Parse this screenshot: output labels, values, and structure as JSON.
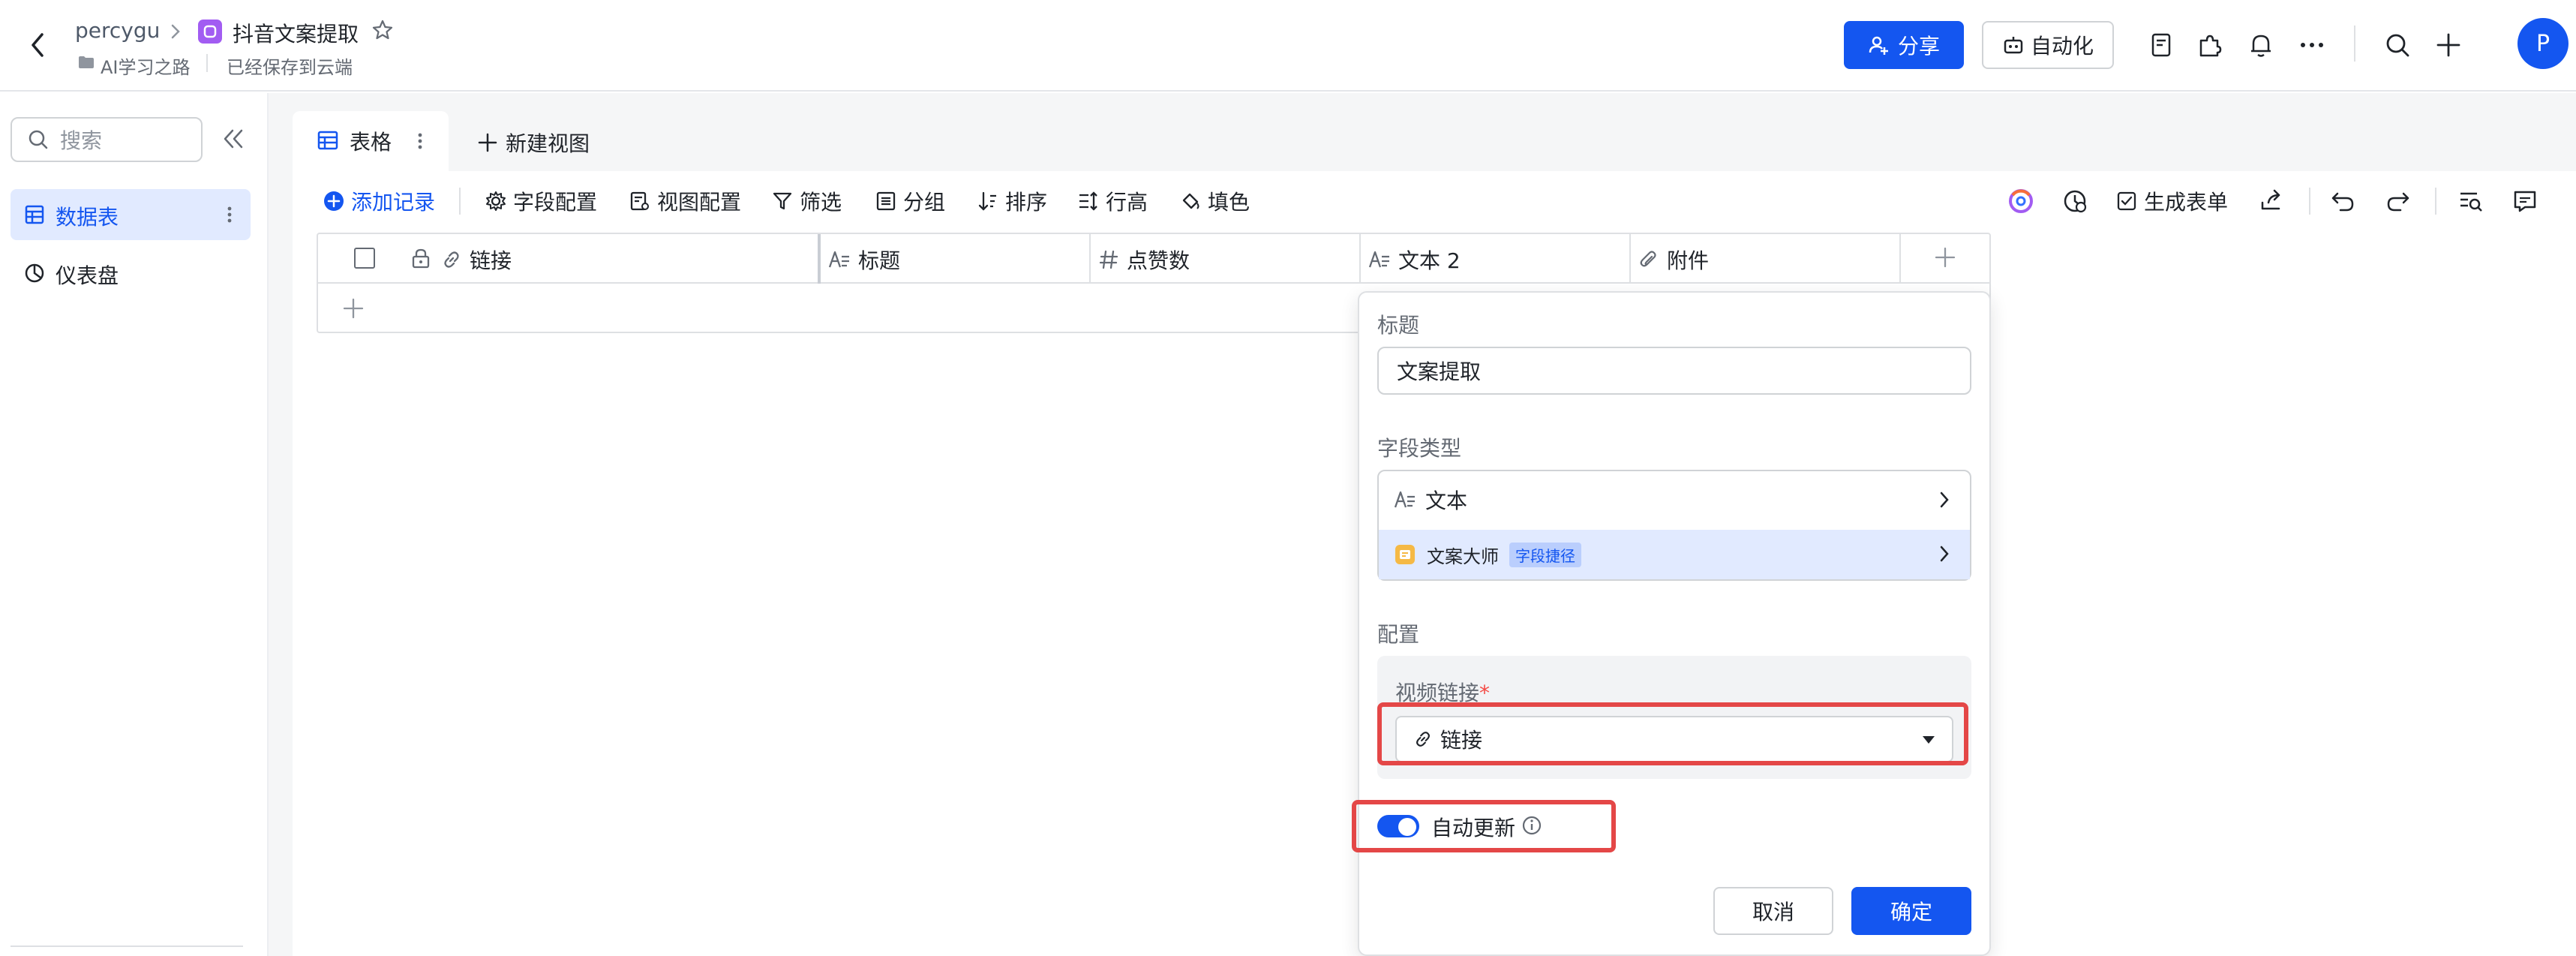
{
  "header": {
    "breadcrumb_user": "percygu",
    "doc_title": "抖音文案提取",
    "folder": "AI学习之路",
    "save_status": "已经保存到云端",
    "share_label": "分享",
    "automation_label": "自动化",
    "avatar_letter": "P"
  },
  "sidebar": {
    "search_placeholder": "搜索",
    "items": [
      {
        "label": "数据表",
        "active": true
      },
      {
        "label": "仪表盘",
        "active": false
      }
    ]
  },
  "views": {
    "tabs": [
      {
        "label": "表格"
      }
    ],
    "new_view_label": "新建视图"
  },
  "toolbar": {
    "add_record": "添加记录",
    "field_config": "字段配置",
    "view_config": "视图配置",
    "filter": "筛选",
    "group": "分组",
    "sort": "排序",
    "row_height": "行高",
    "fill": "填色",
    "generate_form": "生成表单"
  },
  "table": {
    "columns": [
      {
        "label": "链接",
        "icon": "link-icon"
      },
      {
        "label": "标题",
        "icon": "text-icon"
      },
      {
        "label": "点赞数",
        "icon": "number-icon"
      },
      {
        "label": "文本 2",
        "icon": "text-icon"
      },
      {
        "label": "附件",
        "icon": "attachment-icon"
      }
    ]
  },
  "field_popup": {
    "title_label": "标题",
    "title_value": "文案提取",
    "type_label": "字段类型",
    "type_value": "文本",
    "shortcut_name": "文案大师",
    "shortcut_badge": "字段捷径",
    "config_label": "配置",
    "video_link_label": "视频链接",
    "required_mark": "*",
    "video_link_value": "链接",
    "auto_update_label": "自动更新",
    "auto_update_on": true,
    "cancel_label": "取消",
    "ok_label": "确定"
  },
  "colors": {
    "primary": "#1456f0",
    "highlight_red": "#e44747",
    "selected_bg": "#e1eaff"
  }
}
